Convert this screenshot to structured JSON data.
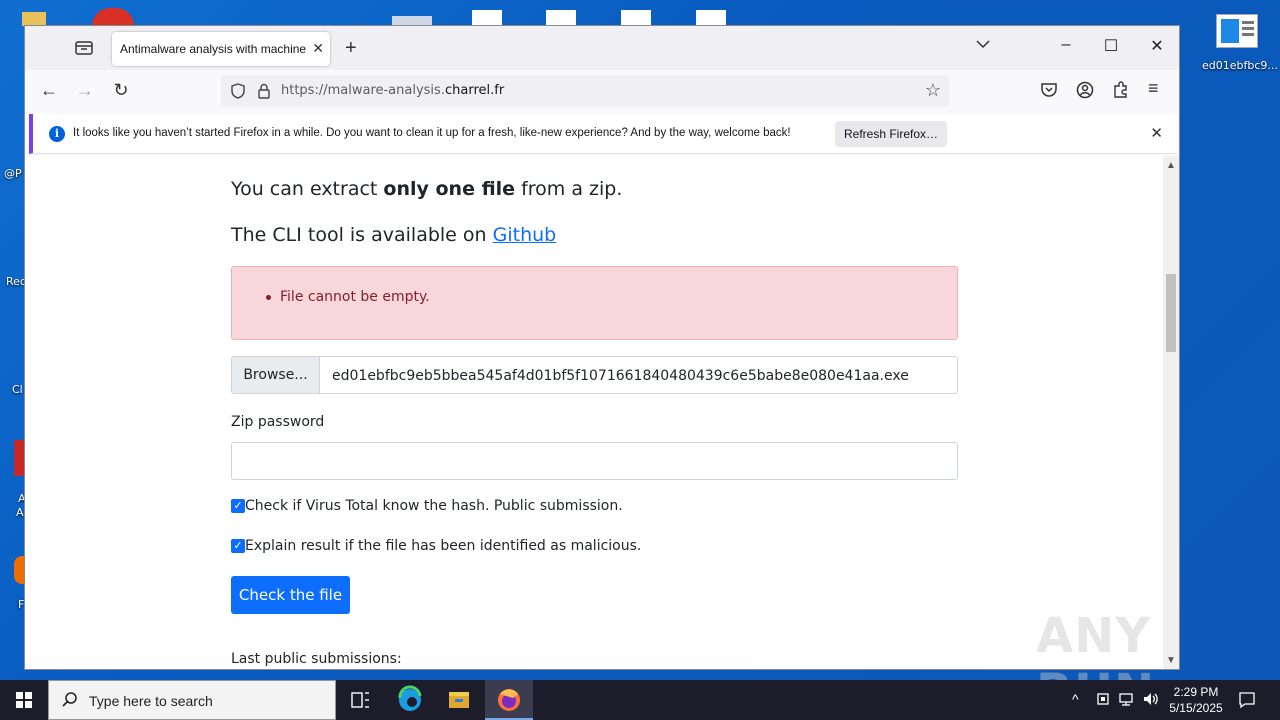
{
  "desktop": {
    "icon_label": "ed01ebfbc9...",
    "partial_labels": [
      "@P",
      "Rec",
      "Cl",
      "A",
      "A",
      "F"
    ]
  },
  "browser": {
    "tab_title": "Antimalware analysis with machine",
    "url_prefix": "https://malware-analysis.",
    "url_domain": "charrel.fr",
    "notification_text": "It looks like you haven’t started Firefox in a while. Do you want to clean it up for a fresh, like-new experience? And by the way, welcome back!",
    "notification_button": "Refresh Firefox…"
  },
  "page": {
    "line1_a": "You can extract ",
    "line1_b": "only one file",
    "line1_c": " from a zip.",
    "line2_a": "The CLI tool is available on ",
    "github_link": "Github",
    "error_item": "File cannot be empty.",
    "browse_label": "Browse...",
    "file_name": "ed01ebfbc9eb5bbea545af4d01bf5f1071661840480439c6e5babe8e080e41aa.exe",
    "zip_password_label": "Zip password",
    "zip_password_value": "",
    "check_virustotal": "Check if Virus Total know the hash. Public submission.",
    "check_explain": "Explain result if the file has been identified as malicious.",
    "submit_label": "Check the file",
    "last_submissions_label": "Last public submissions:"
  },
  "taskbar": {
    "search_placeholder": "Type here to search",
    "time": "2:29 PM",
    "date": "5/15/2025"
  },
  "watermark": "ANY RUN"
}
